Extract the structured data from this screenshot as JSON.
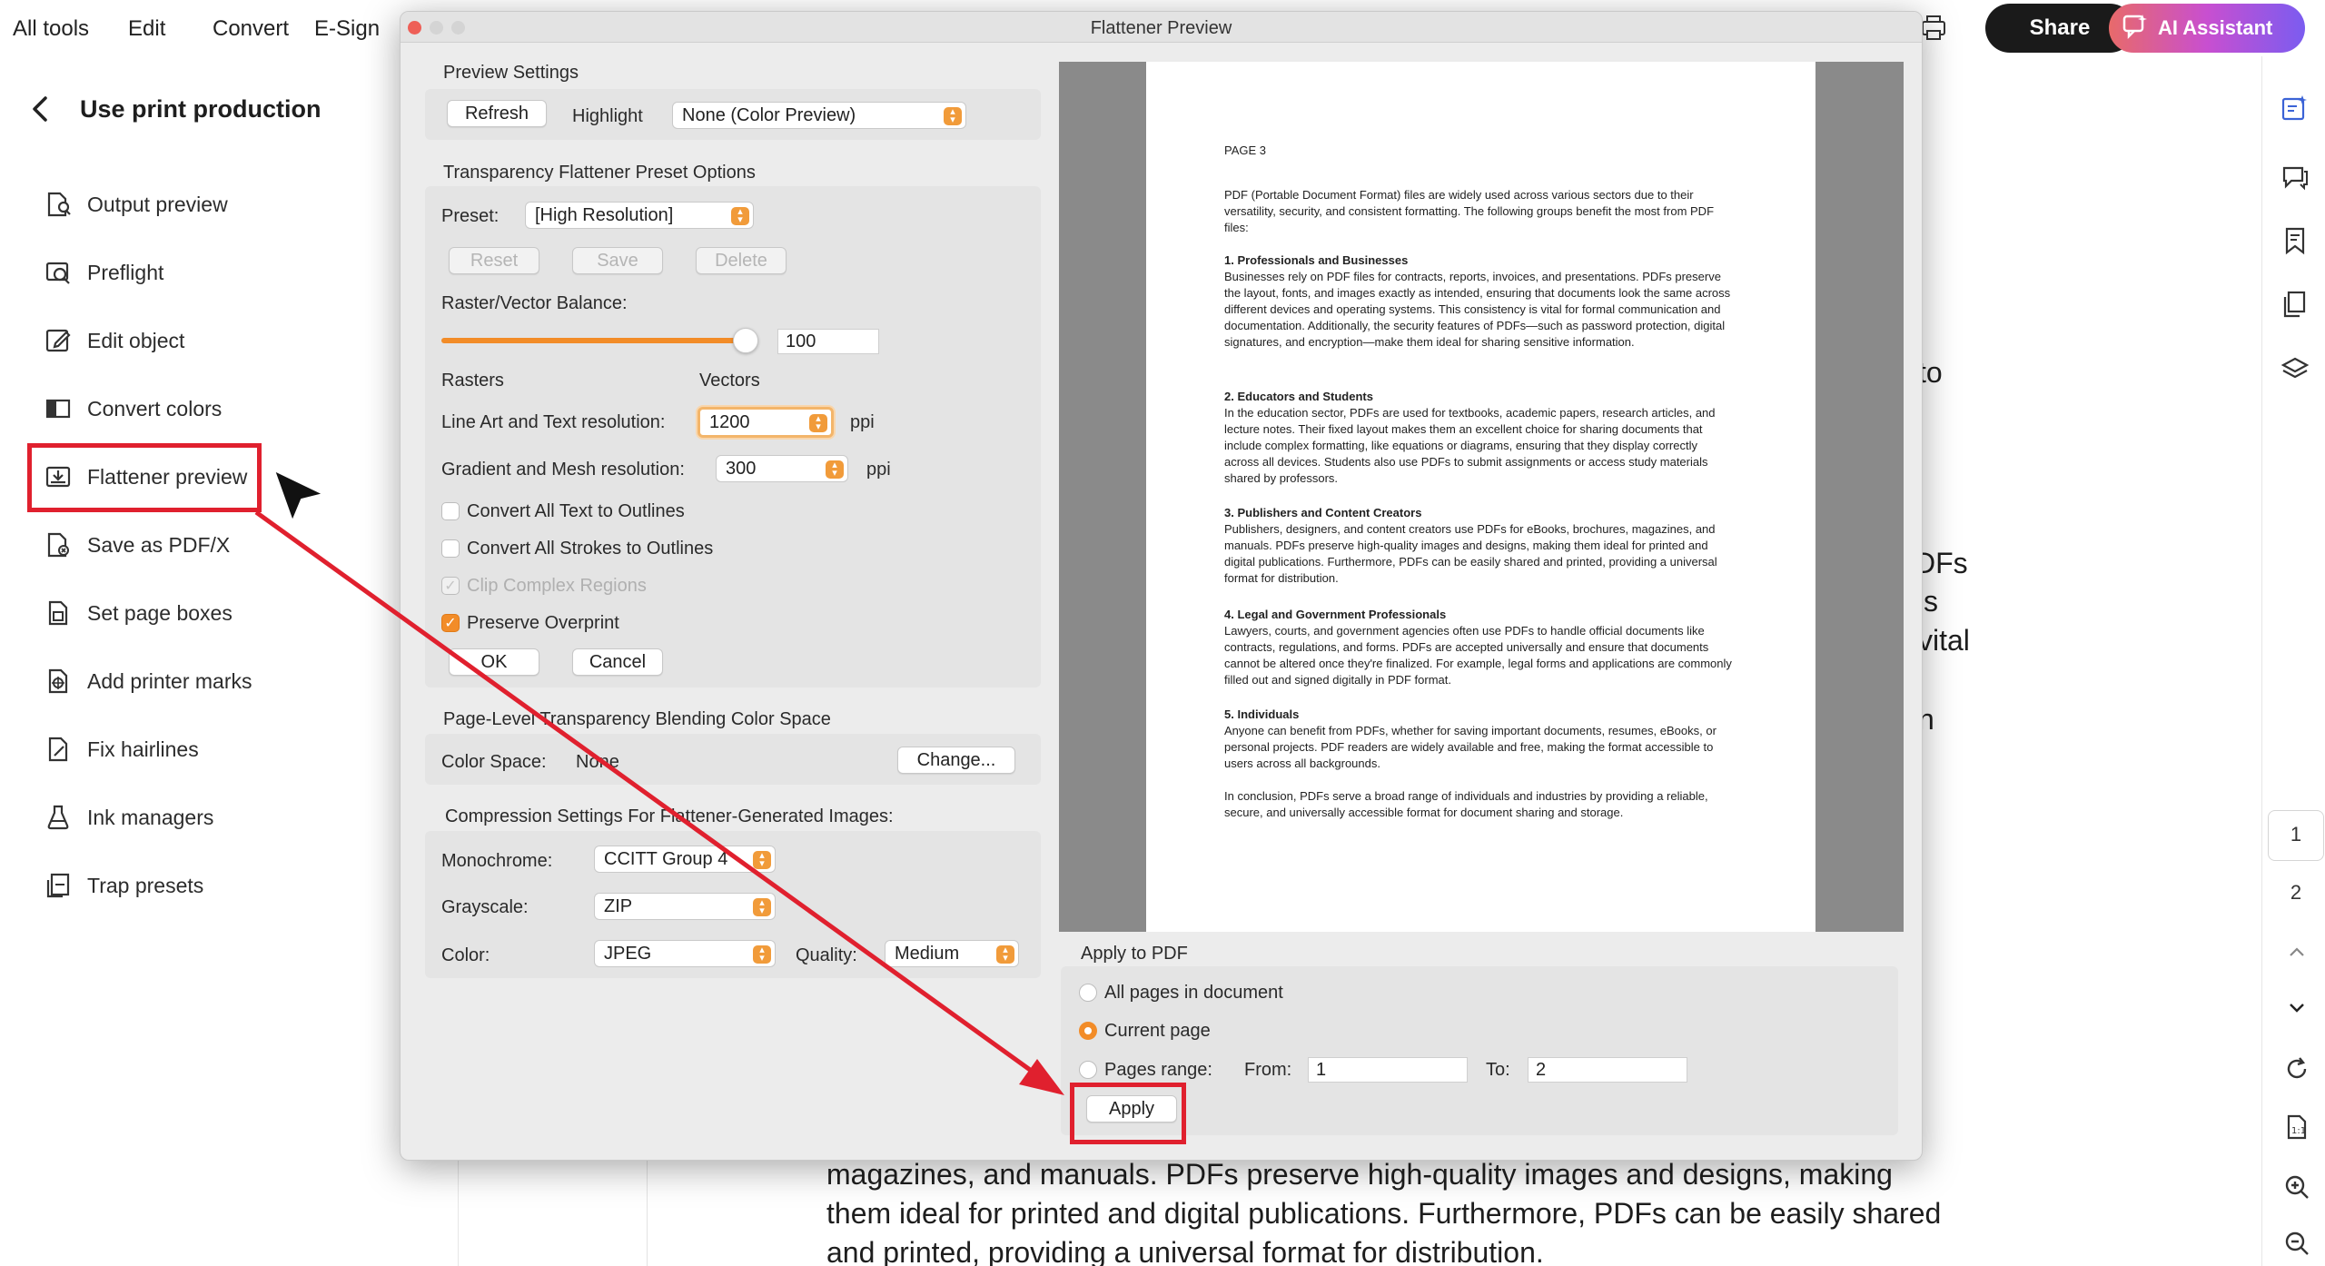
{
  "topbar": {
    "menu": [
      "All tools",
      "Edit",
      "Convert",
      "E-Sign"
    ],
    "share_label": "Share",
    "ai_label": "AI Assistant"
  },
  "left_panel": {
    "title": "Use print production",
    "items": [
      {
        "label": "Output preview",
        "icon": "output-preview-icon"
      },
      {
        "label": "Preflight",
        "icon": "preflight-icon"
      },
      {
        "label": "Edit object",
        "icon": "edit-object-icon"
      },
      {
        "label": "Convert colors",
        "icon": "convert-colors-icon"
      },
      {
        "label": "Flattener preview",
        "icon": "flattener-preview-icon",
        "selected": true
      },
      {
        "label": "Save as PDF/X",
        "icon": "save-pdfx-icon"
      },
      {
        "label": "Set page boxes",
        "icon": "page-boxes-icon"
      },
      {
        "label": "Add printer marks",
        "icon": "printer-marks-icon"
      },
      {
        "label": "Fix hairlines",
        "icon": "fix-hairlines-icon"
      },
      {
        "label": "Ink managers",
        "icon": "ink-managers-icon"
      },
      {
        "label": "Trap presets",
        "icon": "trap-presets-icon"
      }
    ]
  },
  "background_doc": {
    "fragments": [
      "to",
      "DFs",
      "s",
      "vital",
      "n"
    ],
    "lines": [
      "magazines, and manuals. PDFs preserve high-quality images and designs, making",
      "them ideal for printed and digital publications. Furthermore, PDFs can be easily shared",
      "and printed, providing a universal format for distribution."
    ]
  },
  "right_rail": {
    "page_numbers": [
      "1",
      "2"
    ]
  },
  "dialog": {
    "title": "Flattener Preview",
    "preview_settings": {
      "heading": "Preview Settings",
      "refresh_label": "Refresh",
      "highlight_label": "Highlight",
      "highlight_value": "None (Color Preview)"
    },
    "preset_options": {
      "heading": "Transparency Flattener Preset Options",
      "preset_label": "Preset:",
      "preset_value": "[High Resolution]",
      "reset_label": "Reset",
      "save_label": "Save",
      "delete_label": "Delete",
      "balance_label": "Raster/Vector Balance:",
      "balance_value": "100",
      "rasters_label": "Rasters",
      "vectors_label": "Vectors",
      "line_art_label": "Line Art and Text resolution:",
      "line_art_value": "1200",
      "gradient_label": "Gradient and Mesh resolution:",
      "gradient_value": "300",
      "ppi_label": "ppi",
      "convert_text_label": "Convert All Text to Outlines",
      "convert_strokes_label": "Convert All Strokes to Outlines",
      "clip_label": "Clip Complex Regions",
      "preserve_label": "Preserve Overprint",
      "ok_label": "OK",
      "cancel_label": "Cancel"
    },
    "blending": {
      "heading": "Page-Level Transparency Blending Color Space",
      "color_space_label": "Color Space:",
      "color_space_value": "None",
      "change_label": "Change..."
    },
    "compression": {
      "heading": "Compression Settings For Flattener-Generated Images:",
      "mono_label": "Monochrome:",
      "mono_value": "CCITT Group 4",
      "gray_label": "Grayscale:",
      "gray_value": "ZIP",
      "color_label": "Color:",
      "color_value": "JPEG",
      "quality_label": "Quality:",
      "quality_value": "Medium"
    },
    "apply": {
      "heading": "Apply to PDF",
      "all_pages_label": "All pages in document",
      "current_page_label": "Current page",
      "pages_range_label": "Pages range:",
      "from_label": "From:",
      "from_value": "1",
      "to_label": "To:",
      "to_value": "2",
      "apply_label": "Apply"
    },
    "preview_page": {
      "page_label": "PAGE 3",
      "intro": "PDF (Portable Document Format) files are widely used across various sectors due to their versatility, security, and consistent formatting. The following groups benefit the most from PDF files:",
      "sections": [
        {
          "heading": "1. Professionals and Businesses",
          "body": "Businesses rely on PDF files for contracts, reports, invoices, and presentations. PDFs preserve the layout, fonts, and images exactly as intended, ensuring that documents look the same across different devices and operating systems. This consistency is vital for formal communication and documentation. Additionally, the security features of PDFs—such as password protection, digital signatures, and encryption—make them ideal for sharing sensitive information."
        },
        {
          "heading": "2. Educators and Students",
          "body": "In the education sector, PDFs are used for textbooks, academic papers, research articles, and lecture notes. Their fixed layout makes them an excellent choice for sharing documents that include complex formatting, like equations or diagrams, ensuring that they display correctly across all devices. Students also use PDFs to submit assignments or access study materials shared by professors."
        },
        {
          "heading": "3. Publishers and Content Creators",
          "body": "Publishers, designers, and content creators use PDFs for eBooks, brochures, magazines, and manuals. PDFs preserve high-quality images and designs, making them ideal for printed and digital publications. Furthermore, PDFs can be easily shared and printed, providing a universal format for distribution."
        },
        {
          "heading": "4. Legal and Government Professionals",
          "body": "Lawyers, courts, and government agencies often use PDFs to handle official documents like contracts, regulations, and forms. PDFs are accepted universally and ensure that documents cannot be altered once they're finalized. For example, legal forms and applications are commonly filled out and signed digitally in PDF format."
        },
        {
          "heading": "5. Individuals",
          "body": "Anyone can benefit from PDFs, whether for saving important documents, resumes, eBooks, or personal projects. PDF readers are widely available and free, making the format accessible to users across all backgrounds."
        }
      ],
      "conclusion": "In conclusion, PDFs serve a broad range of individuals and industries by providing a reliable, secure, and universally accessible format for document sharing and storage."
    }
  },
  "colors": {
    "accent": "#f28c28",
    "highlight_red": "#e0202e"
  }
}
